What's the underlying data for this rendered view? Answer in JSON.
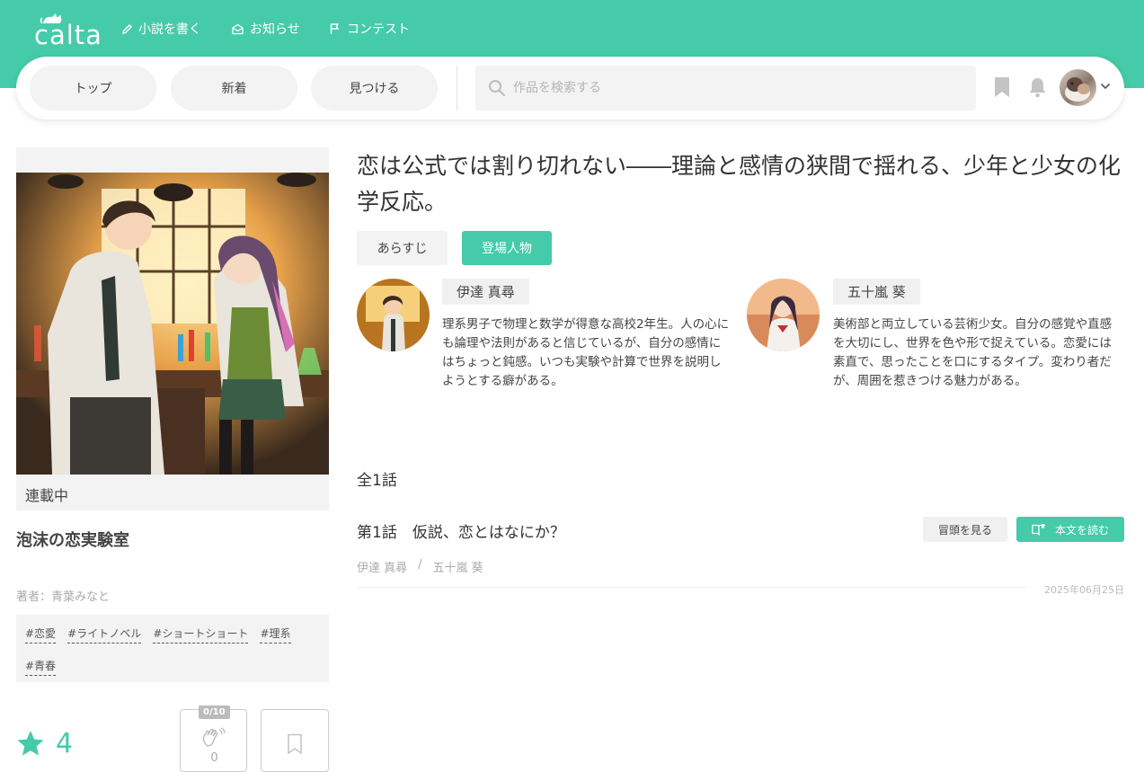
{
  "header": {
    "logo_text": "calta",
    "nav": [
      {
        "label": "小説を書く",
        "icon": "pencil-icon"
      },
      {
        "label": "お知らせ",
        "icon": "envelope-icon"
      },
      {
        "label": "コンテスト",
        "icon": "flag-icon"
      }
    ],
    "accent_color": "#45cba9"
  },
  "navbar": {
    "pills": [
      "トップ",
      "新着",
      "見つける"
    ],
    "search_placeholder": "作品を検索する",
    "icons": [
      "bookmark-icon",
      "bell-icon",
      "avatar",
      "chevron-down-icon"
    ]
  },
  "work": {
    "status": "連載中",
    "title": "泡沫の恋実験室",
    "author": "著者：青葉みなと",
    "tags": [
      "#恋愛",
      "#ライトノベル",
      "#ショートショート",
      "#理系",
      "#青春"
    ],
    "rating": "4",
    "clap_limit": "0/10",
    "clap_count": "0",
    "headline": "恋は公式では割り切れない――理論と感情の狭間で揺れる、少年と少女の化学反応。"
  },
  "tabs": {
    "synopsis": "あらすじ",
    "characters": "登場人物"
  },
  "characters": [
    {
      "name": "伊達 真尋",
      "description": "理系男子で物理と数学が得意な高校2年生。人の心にも論理や法則があると信じているが、自分の感情にはちょっと鈍感。いつも実験や計算で世界を説明しようとする癖がある。"
    },
    {
      "name": "五十嵐 葵",
      "description": "美術部と両立している芸術少女。自分の感覚や直感を大切にし、世界を色や形で捉えている。恋愛には素直で、思ったことを口にするタイプ。変わり者だが、周囲を惹きつける魅力がある。"
    }
  ],
  "episodes": {
    "count_label": "全1話",
    "items": [
      {
        "title": "第1話　仮説、恋とはなにか？",
        "preview_label": "冒頭を見る",
        "read_label": "本文を読む",
        "characters": [
          "伊達 真尋",
          "五十嵐 葵"
        ],
        "separator": "/",
        "date": "2025年06月25日"
      }
    ]
  }
}
